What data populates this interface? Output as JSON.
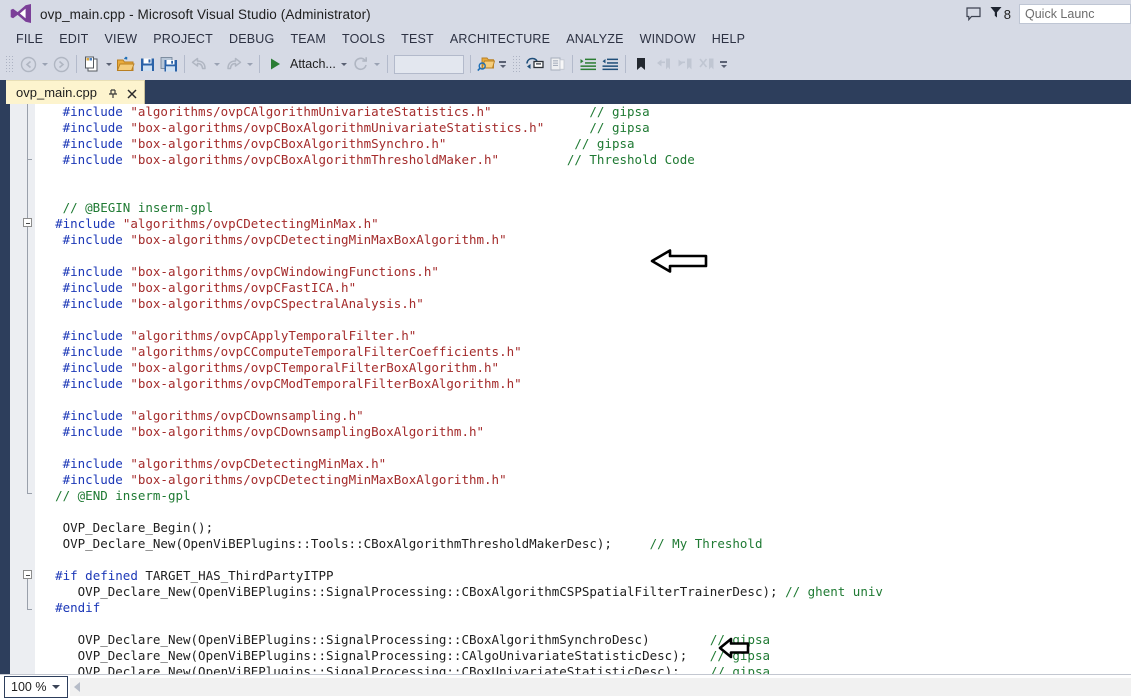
{
  "window": {
    "title": "ovp_main.cpp - Microsoft Visual Studio (Administrator)",
    "logo_icon": "visual-studio-logo-icon"
  },
  "title_right": {
    "feedback_icon": "speech-bubble-icon",
    "notifications_icon": "notification-flag-icon",
    "notifications_count": "8",
    "quick_launch_placeholder": "Quick Launc",
    "quick_launch_value": ""
  },
  "menu": {
    "items": [
      {
        "label": "FILE"
      },
      {
        "label": "EDIT"
      },
      {
        "label": "VIEW"
      },
      {
        "label": "PROJECT"
      },
      {
        "label": "DEBUG"
      },
      {
        "label": "TEAM"
      },
      {
        "label": "TOOLS"
      },
      {
        "label": "TEST"
      },
      {
        "label": "ARCHITECTURE"
      },
      {
        "label": "ANALYZE"
      },
      {
        "label": "WINDOW"
      },
      {
        "label": "HELP"
      }
    ]
  },
  "toolbar": {
    "navigate_back_icon": "navigate-back-icon",
    "navigate_forward_icon": "navigate-forward-icon",
    "new_item_icon": "new-item-icon",
    "open_file_icon": "open-file-icon",
    "save_icon": "save-icon",
    "save_all_icon": "save-all-icon",
    "undo_icon": "undo-icon",
    "redo_icon": "redo-icon",
    "start_debug_icon": "start-debug-play-icon",
    "attach_label": "Attach...",
    "refresh_icon": "refresh-icon",
    "config_combo_value": "",
    "find_icon": "find-in-files-icon",
    "toggle_bookmark_icon": "bookmark-icon",
    "comment_icon": "comment-selection-icon",
    "uncomment_icon": "uncomment-selection-icon",
    "indent_icon": "increase-indent-icon",
    "outdent_icon": "decrease-indent-icon",
    "prev_bookmark_icon": "previous-bookmark-icon",
    "next_bookmark_icon": "next-bookmark-icon",
    "clear_bookmarks_icon": "clear-bookmarks-icon",
    "overflow_icon": "toolbar-overflow-icon"
  },
  "document_tab": {
    "label": "ovp_main.cpp",
    "pin_icon": "pin-icon",
    "close_icon": "close-icon"
  },
  "status": {
    "zoom_level": "100 %",
    "zoom_caret_icon": "chevron-down-icon",
    "hscroll_left_icon": "scroll-left-arrow-icon"
  },
  "annotations": [
    {
      "name": "arrow-threshold-include",
      "icon": "left-block-arrow-icon"
    },
    {
      "name": "arrow-my-threshold-declare",
      "icon": "left-block-arrow-icon"
    }
  ],
  "code": {
    "lines": [
      {
        "indent": 3,
        "tokens": [
          {
            "t": "pp",
            "v": "#include"
          },
          {
            "t": "txt",
            "v": " "
          },
          {
            "t": "str",
            "v": "\"algorithms/ovpCAlgorithmUnivariateStatistics.h\""
          },
          {
            "t": "txt",
            "v": "             "
          },
          {
            "t": "com",
            "v": "// gipsa"
          }
        ]
      },
      {
        "indent": 3,
        "tokens": [
          {
            "t": "pp",
            "v": "#include"
          },
          {
            "t": "txt",
            "v": " "
          },
          {
            "t": "str",
            "v": "\"box-algorithms/ovpCBoxAlgorithmUnivariateStatistics.h\""
          },
          {
            "t": "txt",
            "v": "      "
          },
          {
            "t": "com",
            "v": "// gipsa"
          }
        ]
      },
      {
        "indent": 3,
        "tokens": [
          {
            "t": "pp",
            "v": "#include"
          },
          {
            "t": "txt",
            "v": " "
          },
          {
            "t": "str",
            "v": "\"box-algorithms/ovpCBoxAlgorithmSynchro.h\""
          },
          {
            "t": "txt",
            "v": "                 "
          },
          {
            "t": "com",
            "v": "// gipsa"
          }
        ]
      },
      {
        "indent": 3,
        "tokens": [
          {
            "t": "pp",
            "v": "#include"
          },
          {
            "t": "txt",
            "v": " "
          },
          {
            "t": "str",
            "v": "\"box-algorithms/ovpCBoxAlgorithmThresholdMaker.h\""
          },
          {
            "t": "txt",
            "v": "         "
          },
          {
            "t": "com",
            "v": "// Threshold Code"
          }
        ]
      },
      {
        "indent": 0,
        "tokens": []
      },
      {
        "indent": 0,
        "tokens": []
      },
      {
        "indent": 3,
        "tokens": [
          {
            "t": "com",
            "v": "// @BEGIN inserm-gpl"
          }
        ]
      },
      {
        "indent": 2,
        "tokens": [
          {
            "t": "pp",
            "v": "#include"
          },
          {
            "t": "txt",
            "v": " "
          },
          {
            "t": "str",
            "v": "\"algorithms/ovpCDetectingMinMax.h\""
          }
        ]
      },
      {
        "indent": 3,
        "tokens": [
          {
            "t": "pp",
            "v": "#include"
          },
          {
            "t": "txt",
            "v": " "
          },
          {
            "t": "str",
            "v": "\"box-algorithms/ovpCDetectingMinMaxBoxAlgorithm.h\""
          }
        ]
      },
      {
        "indent": 0,
        "tokens": []
      },
      {
        "indent": 3,
        "tokens": [
          {
            "t": "pp",
            "v": "#include"
          },
          {
            "t": "txt",
            "v": " "
          },
          {
            "t": "str",
            "v": "\"box-algorithms/ovpCWindowingFunctions.h\""
          }
        ]
      },
      {
        "indent": 3,
        "tokens": [
          {
            "t": "pp",
            "v": "#include"
          },
          {
            "t": "txt",
            "v": " "
          },
          {
            "t": "str",
            "v": "\"box-algorithms/ovpCFastICA.h\""
          }
        ]
      },
      {
        "indent": 3,
        "tokens": [
          {
            "t": "pp",
            "v": "#include"
          },
          {
            "t": "txt",
            "v": " "
          },
          {
            "t": "str",
            "v": "\"box-algorithms/ovpCSpectralAnalysis.h\""
          }
        ]
      },
      {
        "indent": 0,
        "tokens": []
      },
      {
        "indent": 3,
        "tokens": [
          {
            "t": "pp",
            "v": "#include"
          },
          {
            "t": "txt",
            "v": " "
          },
          {
            "t": "str",
            "v": "\"algorithms/ovpCApplyTemporalFilter.h\""
          }
        ]
      },
      {
        "indent": 3,
        "tokens": [
          {
            "t": "pp",
            "v": "#include"
          },
          {
            "t": "txt",
            "v": " "
          },
          {
            "t": "str",
            "v": "\"algorithms/ovpCComputeTemporalFilterCoefficients.h\""
          }
        ]
      },
      {
        "indent": 3,
        "tokens": [
          {
            "t": "pp",
            "v": "#include"
          },
          {
            "t": "txt",
            "v": " "
          },
          {
            "t": "str",
            "v": "\"box-algorithms/ovpCTemporalFilterBoxAlgorithm.h\""
          }
        ]
      },
      {
        "indent": 3,
        "tokens": [
          {
            "t": "pp",
            "v": "#include"
          },
          {
            "t": "txt",
            "v": " "
          },
          {
            "t": "str",
            "v": "\"box-algorithms/ovpCModTemporalFilterBoxAlgorithm.h\""
          }
        ]
      },
      {
        "indent": 0,
        "tokens": []
      },
      {
        "indent": 3,
        "tokens": [
          {
            "t": "pp",
            "v": "#include"
          },
          {
            "t": "txt",
            "v": " "
          },
          {
            "t": "str",
            "v": "\"algorithms/ovpCDownsampling.h\""
          }
        ]
      },
      {
        "indent": 3,
        "tokens": [
          {
            "t": "pp",
            "v": "#include"
          },
          {
            "t": "txt",
            "v": " "
          },
          {
            "t": "str",
            "v": "\"box-algorithms/ovpCDownsamplingBoxAlgorithm.h\""
          }
        ]
      },
      {
        "indent": 0,
        "tokens": []
      },
      {
        "indent": 3,
        "tokens": [
          {
            "t": "pp",
            "v": "#include"
          },
          {
            "t": "txt",
            "v": " "
          },
          {
            "t": "str",
            "v": "\"algorithms/ovpCDetectingMinMax.h\""
          }
        ]
      },
      {
        "indent": 3,
        "tokens": [
          {
            "t": "pp",
            "v": "#include"
          },
          {
            "t": "txt",
            "v": " "
          },
          {
            "t": "str",
            "v": "\"box-algorithms/ovpCDetectingMinMaxBoxAlgorithm.h\""
          }
        ]
      },
      {
        "indent": 2,
        "tokens": [
          {
            "t": "com",
            "v": "// @END inserm-gpl"
          }
        ]
      },
      {
        "indent": 0,
        "tokens": []
      },
      {
        "indent": 3,
        "tokens": [
          {
            "t": "txt",
            "v": "OVP_Declare_Begin();"
          }
        ]
      },
      {
        "indent": 3,
        "tokens": [
          {
            "t": "txt",
            "v": "OVP_Declare_New(OpenViBEPlugins::Tools::CBoxAlgorithmThresholdMakerDesc);"
          },
          {
            "t": "txt",
            "v": "     "
          },
          {
            "t": "com",
            "v": "// My Threshold"
          }
        ]
      },
      {
        "indent": 0,
        "tokens": []
      },
      {
        "indent": 2,
        "tokens": [
          {
            "t": "pp",
            "v": "#if defined"
          },
          {
            "t": "txt",
            "v": " TARGET_HAS_ThirdPartyITPP"
          }
        ]
      },
      {
        "indent": 5,
        "tokens": [
          {
            "t": "txt",
            "v": "OVP_Declare_New(OpenViBEPlugins::SignalProcessing::CBoxAlgorithmCSPSpatialFilterTrainerDesc);"
          },
          {
            "t": "txt",
            "v": " "
          },
          {
            "t": "com",
            "v": "// ghent univ"
          }
        ]
      },
      {
        "indent": 2,
        "tokens": [
          {
            "t": "pp",
            "v": "#endif"
          }
        ]
      },
      {
        "indent": 0,
        "tokens": []
      },
      {
        "indent": 5,
        "tokens": [
          {
            "t": "txt",
            "v": "OVP_Declare_New(OpenViBEPlugins::SignalProcessing::CBoxAlgorithmSynchroDesc)"
          },
          {
            "t": "txt",
            "v": "        "
          },
          {
            "t": "com",
            "v": "// gipsa"
          }
        ]
      },
      {
        "indent": 5,
        "tokens": [
          {
            "t": "txt",
            "v": "OVP_Declare_New(OpenViBEPlugins::SignalProcessing::CAlgoUnivariateStatisticDesc);"
          },
          {
            "t": "txt",
            "v": "   "
          },
          {
            "t": "com",
            "v": "// gipsa"
          }
        ]
      },
      {
        "indent": 5,
        "tokens": [
          {
            "t": "txt",
            "v": "OVP_Declare_New(OpenViBEPlugins::SignalProcessing::CBoxUnivariateStatisticDesc);"
          },
          {
            "t": "txt",
            "v": "    "
          },
          {
            "t": "com",
            "v": "// gipsa"
          }
        ]
      }
    ]
  }
}
